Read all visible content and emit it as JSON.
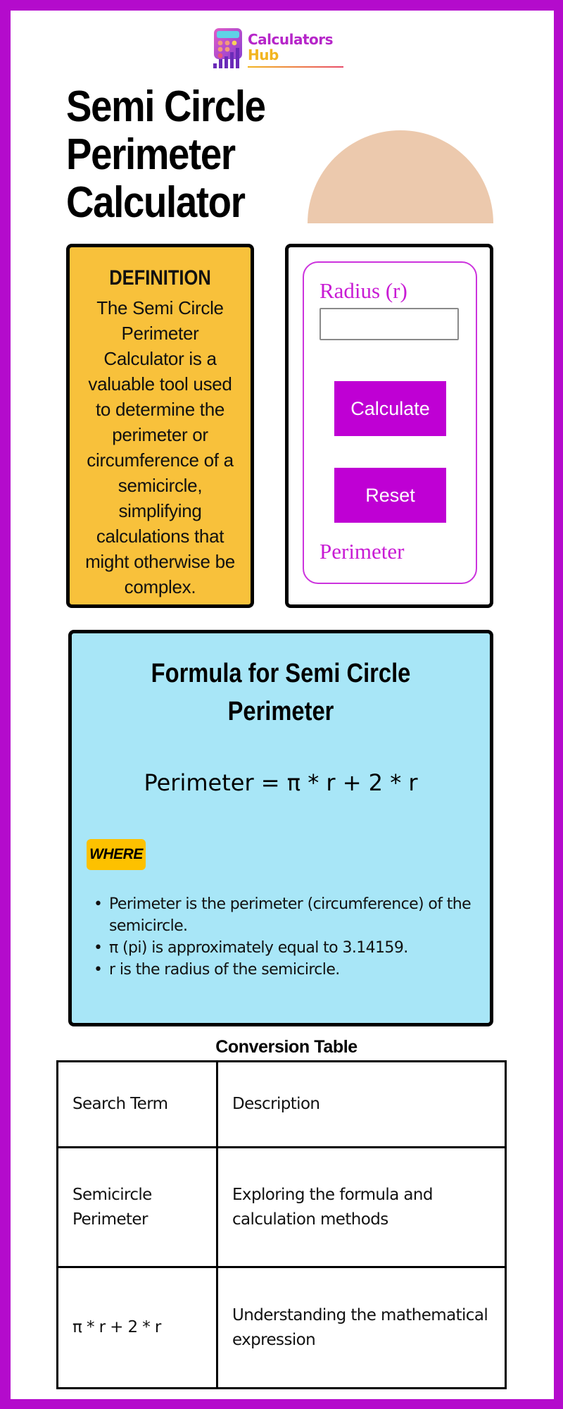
{
  "brand": {
    "name_line1": "Calculators",
    "name_line2": "Hub",
    "primary_color": "#b40bcc",
    "accent_color": "#f2b51f"
  },
  "header": {
    "title": "Semi Circle Perimeter Calculator",
    "shape_color": "#ecc9ad"
  },
  "definition": {
    "heading": "DEFINITION",
    "text": "The Semi Circle Perimeter Calculator is a valuable tool used to determine the perimeter or circumference of a semicircle, simplifying calculations that might otherwise be complex.",
    "bg_color": "#f8c13b"
  },
  "calculator": {
    "radius_label": "Radius (r)",
    "radius_value": "",
    "radius_placeholder": "",
    "calculate_label": "Calculate",
    "reset_label": "Reset",
    "result_label": "Perimeter",
    "button_color": "#bf00d4"
  },
  "formula": {
    "heading": "Formula for Semi Circle Perimeter",
    "equation": "Perimeter = π * r + 2 * r",
    "where_label": "WHERE",
    "items": [
      "Perimeter is the perimeter (circumference) of the semicircle.",
      "π (pi) is approximately equal to 3.14159.",
      "r is the radius of the semicircle."
    ],
    "bg_color": "#a8e6f7"
  },
  "table": {
    "title": "Conversion Table",
    "rows": [
      [
        "Search Term",
        "Description"
      ],
      [
        "Semicircle Perimeter",
        "Exploring the formula and calculation methods"
      ],
      [
        "π * r + 2 * r",
        "Understanding the mathematical expression"
      ]
    ]
  }
}
